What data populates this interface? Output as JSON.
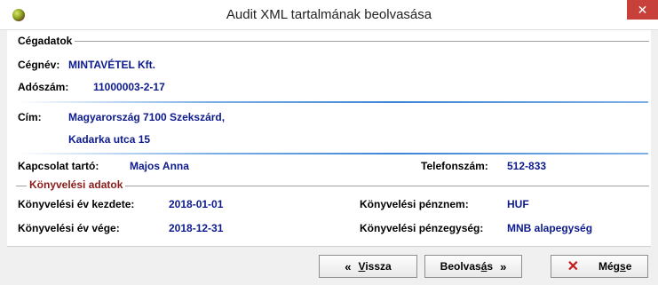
{
  "window": {
    "title": "Audit XML tartalmának beolvasása",
    "close_glyph": "✕"
  },
  "company": {
    "group_title": "Cégadatok",
    "name_label": "Cégnév:",
    "name_value": "MINTAVÉTEL Kft.",
    "tax_label": "Adószám:",
    "tax_value": "11000003-2-17",
    "address_label": "Cím:",
    "address_line1": "Magyarország 7100 Szekszárd,",
    "address_line2": "Kadarka utca 15",
    "contact_label": "Kapcsolat tartó:",
    "contact_value": "Majos Anna",
    "phone_label": "Telefonszám:",
    "phone_value": "512-833"
  },
  "accounting": {
    "group_title": "Könyvelési adatok",
    "start_label": "Könyvelési év kezdete:",
    "start_value": "2018-01-01",
    "end_label": "Könyvelési év vége:",
    "end_value": "2018-12-31",
    "currency_label": "Könyvelési pénznem:",
    "currency_value": "HUF",
    "unit_label": "Könyvelési pénzegység:",
    "unit_value": "MNB alapegység"
  },
  "buttons": {
    "back_icon": "«",
    "back_label_pre": "",
    "back_label_u": "V",
    "back_label_post": "issza",
    "load_label_pre": "Beolvas",
    "load_label_u": "á",
    "load_label_post": "s",
    "load_icon": "»",
    "cancel_icon": "✕",
    "cancel_label_pre": "Még",
    "cancel_label_u": "s",
    "cancel_label_post": "e"
  },
  "colors": {
    "value_text": "#0c1a8c",
    "accounting_title": "#8b1a1a",
    "close_bg": "#c7413a"
  }
}
